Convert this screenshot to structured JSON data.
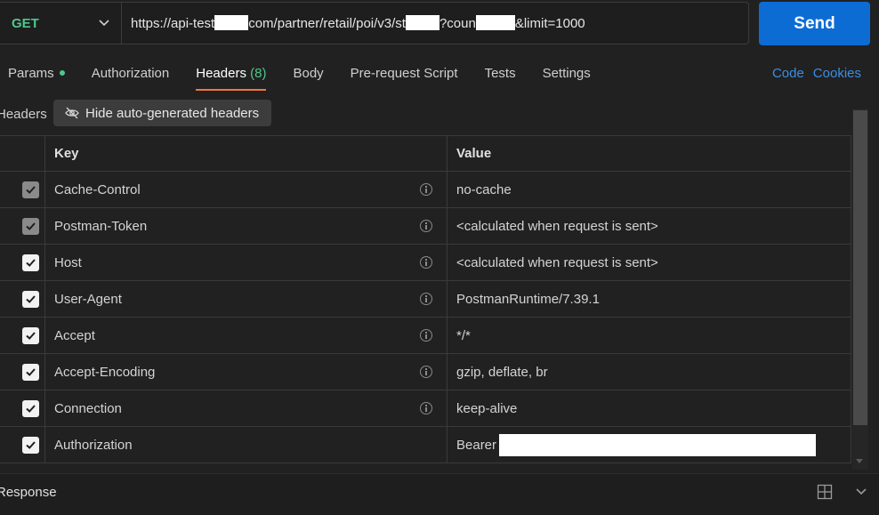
{
  "request": {
    "method": "GET",
    "url_parts": [
      "https://api-test",
      "com/partner/retail/poi/v3/st",
      "?coun",
      "&limit=1000"
    ],
    "send_label": "Send"
  },
  "tabs": [
    {
      "label": "Params",
      "has_dot": true
    },
    {
      "label": "Authorization"
    },
    {
      "label": "Headers",
      "count": "(8)",
      "active": true
    },
    {
      "label": "Body"
    },
    {
      "label": "Pre-request Script"
    },
    {
      "label": "Tests"
    },
    {
      "label": "Settings"
    }
  ],
  "links": {
    "code": "Code",
    "cookies": "Cookies"
  },
  "headers_section": {
    "label": "Headers",
    "hide_button": "Hide auto-generated headers"
  },
  "table": {
    "columns": {
      "key": "Key",
      "value": "Value"
    },
    "rows": [
      {
        "key": "Cache-Control",
        "value": "no-cache",
        "checked": true,
        "disabled": true,
        "info": true
      },
      {
        "key": "Postman-Token",
        "value": "<calculated when request is sent>",
        "checked": true,
        "disabled": true,
        "info": true
      },
      {
        "key": "Host",
        "value": "<calculated when request is sent>",
        "checked": true,
        "disabled": false,
        "info": true
      },
      {
        "key": "User-Agent",
        "value": "PostmanRuntime/7.39.1",
        "checked": true,
        "disabled": false,
        "info": true
      },
      {
        "key": "Accept",
        "value": "*/*",
        "checked": true,
        "disabled": false,
        "info": true
      },
      {
        "key": "Accept-Encoding",
        "value": "gzip, deflate, br",
        "checked": true,
        "disabled": false,
        "info": true
      },
      {
        "key": "Connection",
        "value": "keep-alive",
        "checked": true,
        "disabled": false,
        "info": true
      },
      {
        "key": "Authorization",
        "value": "Bearer",
        "checked": true,
        "disabled": false,
        "info": false,
        "redacted": true
      }
    ]
  },
  "response": {
    "label": "Response"
  },
  "colors": {
    "accent": "#0c6cd4",
    "method": "#4ec78b",
    "tab_underline": "#f0763b",
    "link": "#3a8ee6"
  }
}
